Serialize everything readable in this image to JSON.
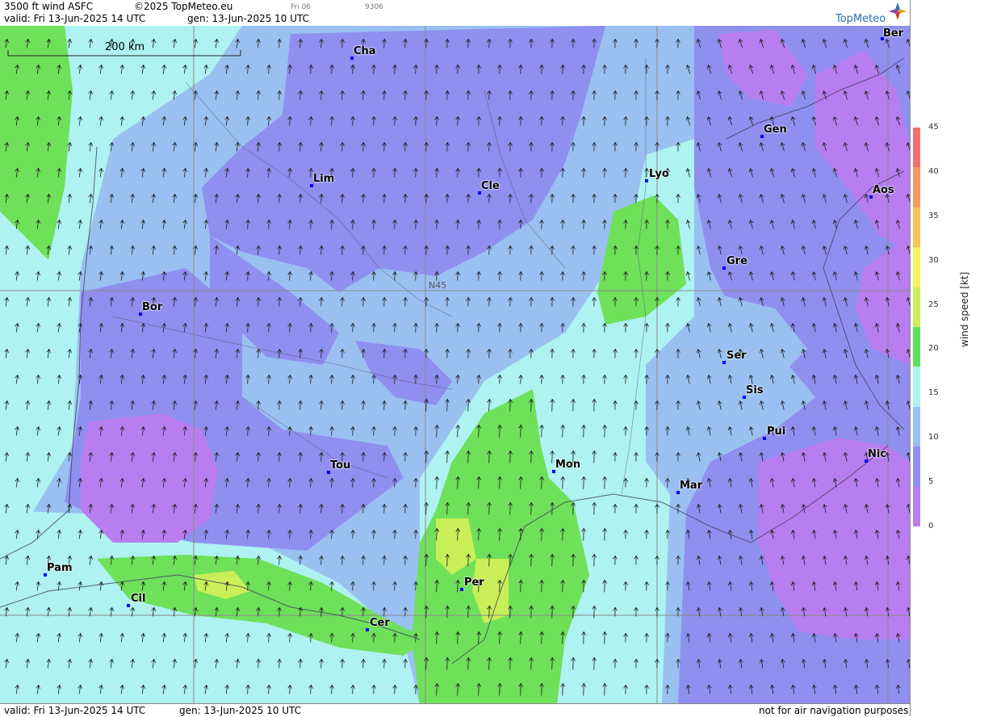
{
  "header": {
    "title": "3500 ft wind ASFC",
    "copyright": "©2025 TopMeteo.eu",
    "small_label_1": "Fri 06",
    "small_label_2": "9306",
    "valid_label": "valid:  Fri  13-Jun-2025  14 UTC",
    "gen_label": "gen: 13-Jun-2025 10 UTC",
    "brand": "TopMeteo"
  },
  "scale_bar": {
    "label": "200 km"
  },
  "grid_label": "N45",
  "cities": {
    "ber": "Ber",
    "cha": "Cha",
    "gen": "Gen",
    "lim": "Lim",
    "cle": "Cle",
    "lyo": "Lyo",
    "aos": "Aos",
    "gre": "Gre",
    "bor": "Bor",
    "ser": "Ser",
    "sis": "Sis",
    "pui": "Pui",
    "tou": "Tou",
    "mon": "Mon",
    "nic": "Nic",
    "mar": "Mar",
    "pam": "Pam",
    "per": "Per",
    "cil": "Cil",
    "cer": "Cer"
  },
  "footer": {
    "valid": "valid:  Fri  13-Jun-2025  14 UTC",
    "gen": "gen: 13-Jun-2025 10 UTC",
    "disclaimer": "not for air navigation purposes"
  },
  "legend": {
    "axis_label": "wind  speed  [kt]",
    "ticks": [
      "45",
      "40",
      "35",
      "30",
      "25",
      "20",
      "15",
      "10",
      "5",
      "0"
    ],
    "colors": [
      "#f2706a",
      "#f59a62",
      "#f7c45a",
      "#f5f25a",
      "#c8ef58",
      "#5fe05a",
      "#aef2f2",
      "#9ac0f2",
      "#8f8ff0",
      "#b87ef0"
    ]
  },
  "colors": {
    "calm": "#b87ef0",
    "light": "#8f8ff0",
    "moderate": "#9ac0f2",
    "fresh": "#aef2f2",
    "strong": "#6fe05a",
    "stronger": "#c8ef58"
  }
}
